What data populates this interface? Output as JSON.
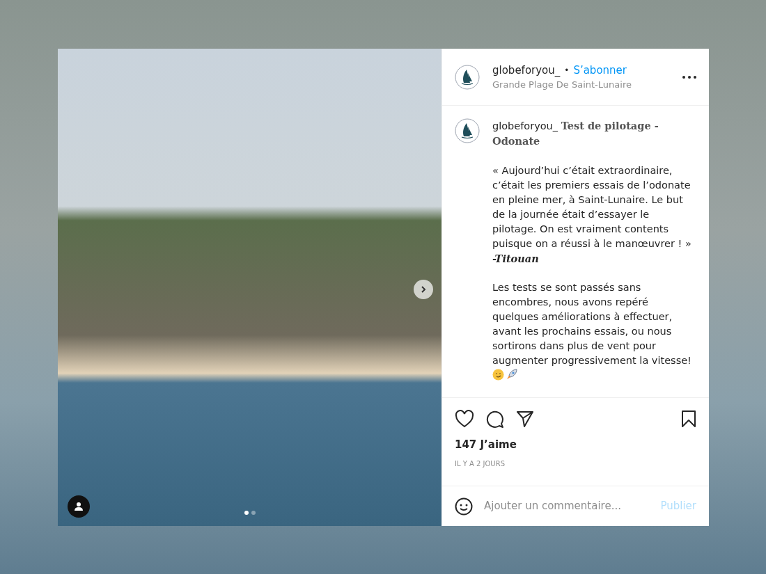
{
  "post": {
    "photo": {
      "dots": [
        {
          "selected": true
        },
        {
          "selected": false
        }
      ]
    },
    "header": {
      "username": "globeforyou_",
      "separator": "•",
      "follow": "S’abonner",
      "location": "Grande Plage De Saint-Lunaire"
    },
    "caption": {
      "username": "globeforyou_",
      "title": "Test de pilotage - Odonate",
      "quote": "« Aujourd’hui c’était extraordinaire, c’était les premiers essais de l’odonate en pleine mer, à Saint-Lunaire. Le but de la journée était d’essayer le pilotage. On est vraiment contents puisque on a réussi à le manœuvrer ! »",
      "signature": "-Titouan",
      "body": "Les tests se sont passés sans encombres, nous avons repéré quelques améliorations à effectuer, avant les prochains essais, ou nous sortirons dans plus de vent pour augmenter progressivement la vitesse!"
    },
    "likes": "147 J’aime",
    "time": "IL Y A 2 JOURS",
    "comment": {
      "placeholder": "Ajouter un commentaire...",
      "submit": "Publier",
      "submit_disabled": true
    }
  }
}
